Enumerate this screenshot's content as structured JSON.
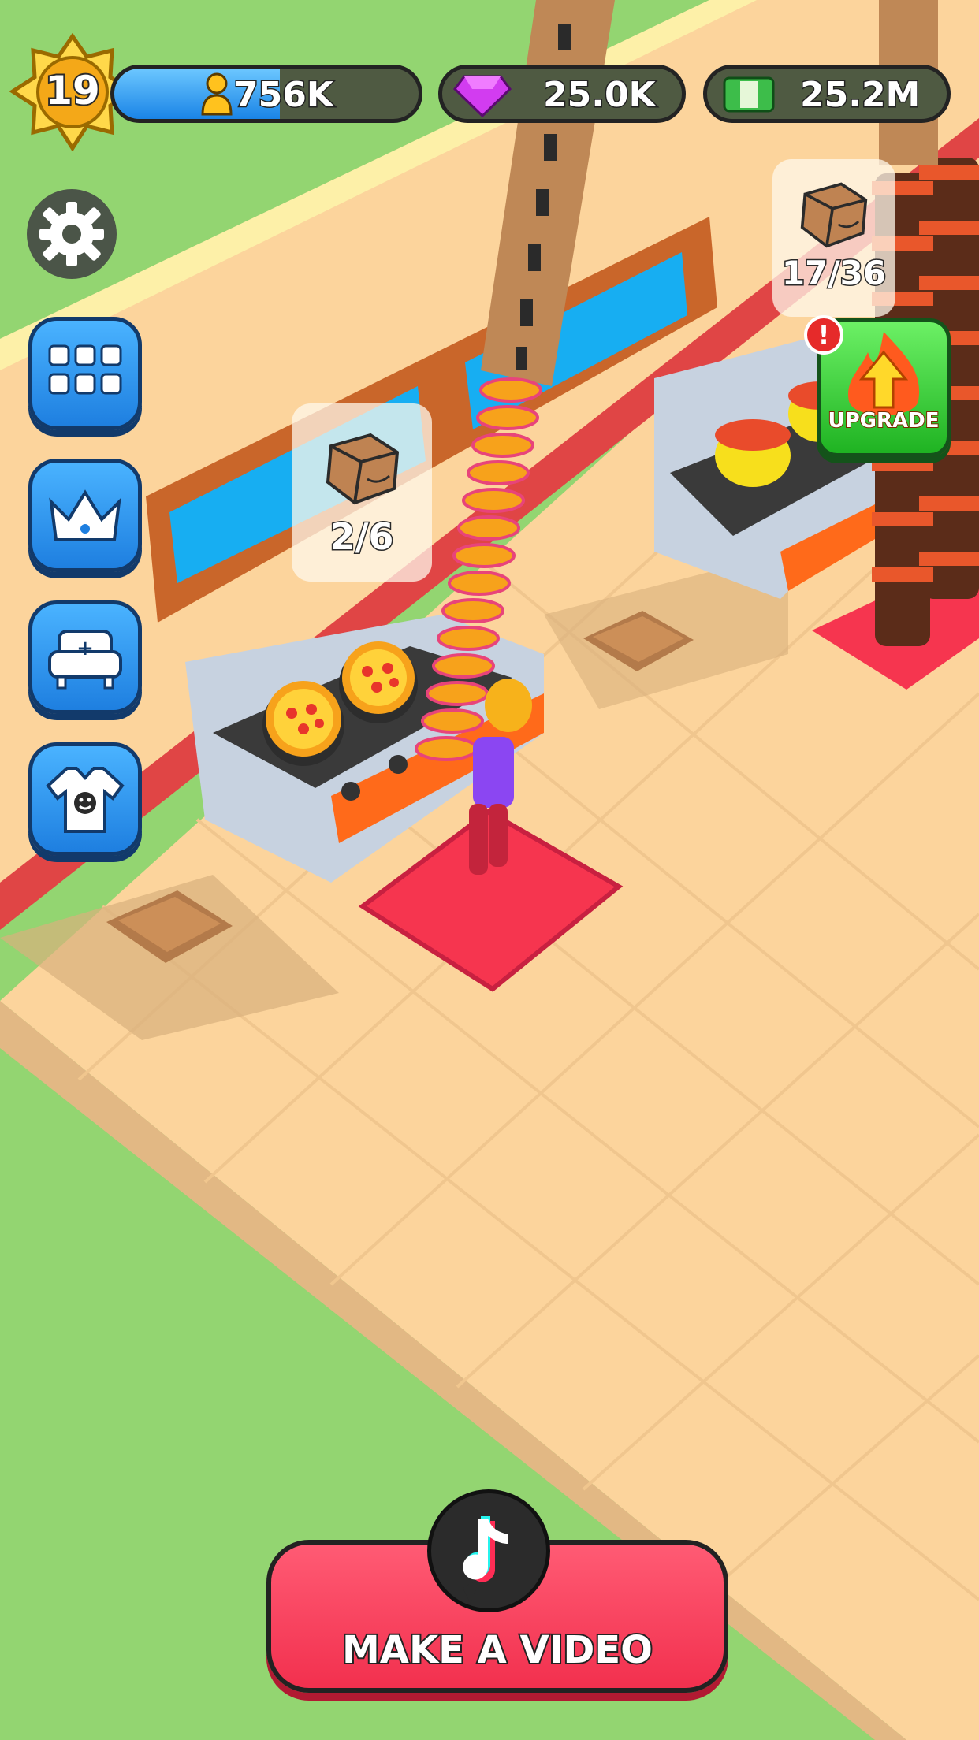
{
  "hud": {
    "level": "19",
    "players": "756K",
    "gems": "25.0K",
    "cash": "25.2M"
  },
  "stations": [
    {
      "counter": "2/6"
    },
    {
      "counter": "17/36"
    }
  ],
  "upgrade": {
    "label": "UPGRADE",
    "alert": "!"
  },
  "actions": {
    "make_video_label": "MAKE A VIDEO"
  },
  "icons": {
    "level": "level-star-badge-icon",
    "players": "player-icon",
    "gems": "gem-icon",
    "cash": "cash-icon",
    "settings": "gear-icon",
    "menu": "grid-icon",
    "vip": "crown-icon",
    "furniture": "sofa-icon",
    "shop": "tshirt-icon",
    "upgrade": "fire-arrow-icon",
    "video": "tiktok-note-icon"
  },
  "colors": {
    "grass": "#93d571",
    "floor": "#fdd89f",
    "accent_blue": "#2f96f2",
    "accent_green": "#38c43a",
    "accent_red": "#f2304e"
  }
}
